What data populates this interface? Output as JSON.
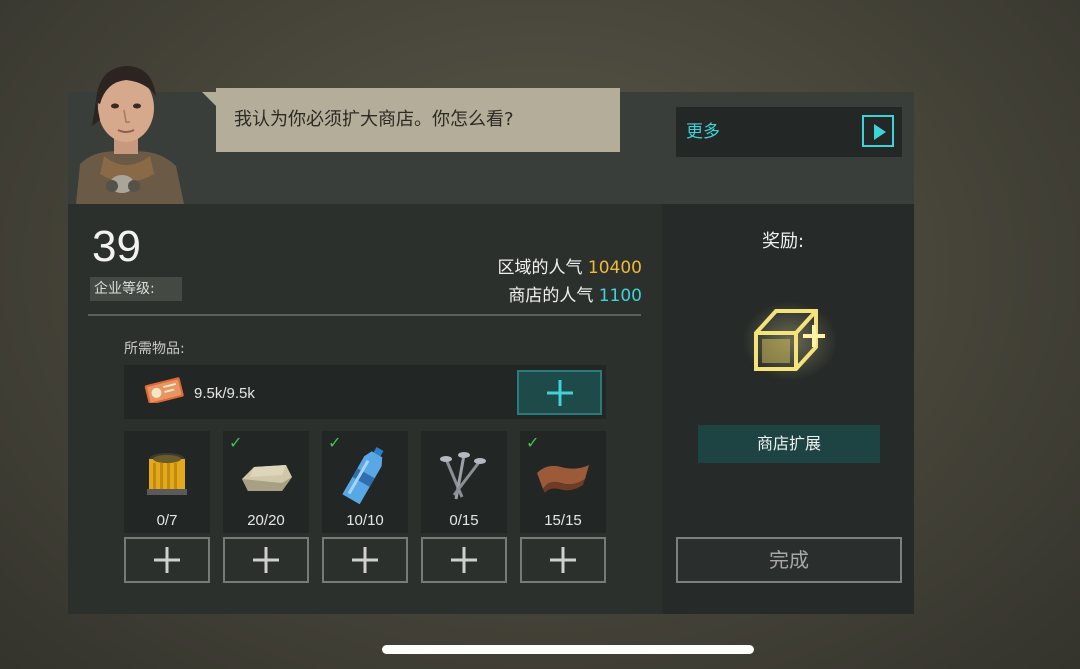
{
  "dialog": {
    "message": "我认为你必须扩大商店。你怎么看?",
    "more_label": "更多"
  },
  "company": {
    "level": "39",
    "level_label": "企业等级:",
    "area_popularity_label": "区域的人气",
    "area_popularity_value": "10400",
    "shop_popularity_label": "商店的人气",
    "shop_popularity_value": "1100"
  },
  "requirements": {
    "label": "所需物品:",
    "money": "9.5k/9.5k",
    "items": [
      {
        "name": "filter",
        "count": "0/7",
        "done": false
      },
      {
        "name": "stone",
        "count": "20/20",
        "done": true
      },
      {
        "name": "water-bottle",
        "count": "10/10",
        "done": true
      },
      {
        "name": "nails",
        "count": "0/15",
        "done": false
      },
      {
        "name": "leather",
        "count": "15/15",
        "done": true
      }
    ],
    "check_mark": "✓"
  },
  "reward": {
    "title": "奖励:",
    "name": "商店扩展",
    "complete_label": "完成"
  },
  "colors": {
    "accent_cyan": "#3ed3d8",
    "accent_yellow": "#f0b93a",
    "check_green": "#41c54a"
  }
}
